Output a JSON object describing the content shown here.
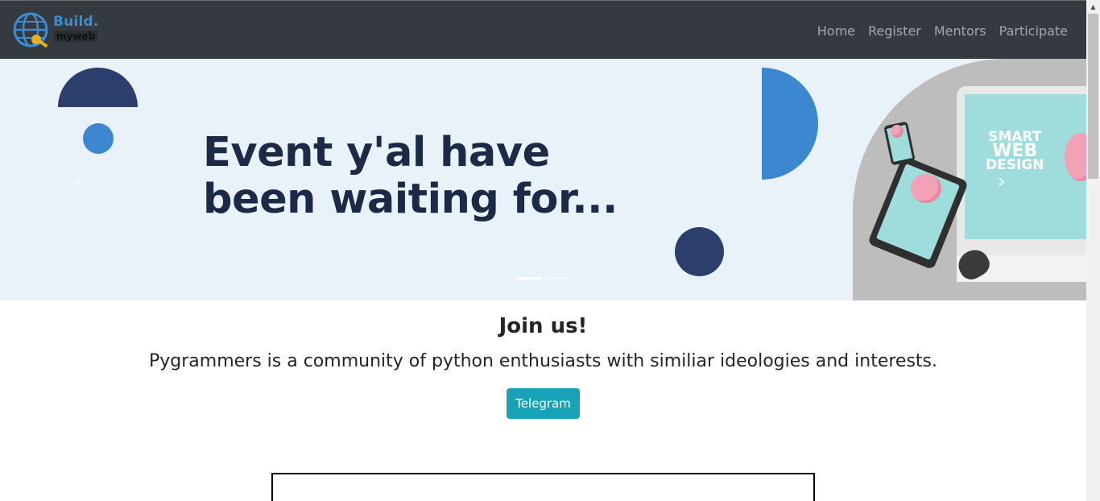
{
  "brand": {
    "line1": "Build.",
    "line2": "myweb",
    "logo_icon": "globe-wrench-icon"
  },
  "nav": {
    "items": [
      {
        "label": "Home"
      },
      {
        "label": "Register"
      },
      {
        "label": "Mentors"
      },
      {
        "label": "Participate"
      }
    ]
  },
  "carousel": {
    "headline_line1": "Event y'al have",
    "headline_line2": "been waiting for...",
    "screen_text_1": "SMART",
    "screen_text_2": "WEB",
    "screen_text_3": "DESIGN",
    "prev_icon": "chevron-left-icon",
    "next_icon": "chevron-right-icon",
    "slide_count": 2,
    "active_slide": 1
  },
  "join": {
    "title": "Join us!",
    "description": "Pygrammers is a community of python enthusiasts with similiar ideologies and interests.",
    "button_label": "Telegram"
  },
  "colors": {
    "navbar": "#343a40",
    "accent_blue": "#3c87cf",
    "navy": "#2b3e6c",
    "button": "#17a2b8",
    "carousel_bg": "#e9f1f9"
  }
}
